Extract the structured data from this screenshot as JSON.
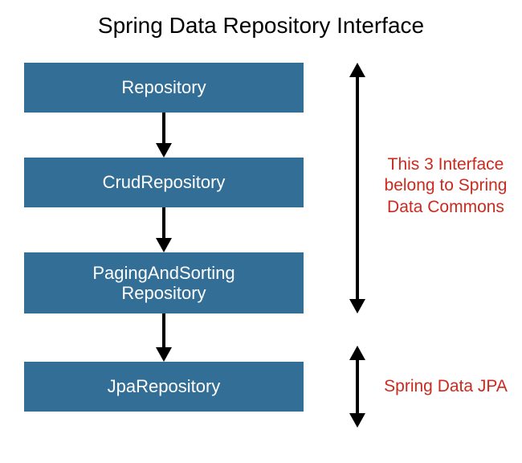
{
  "title": "Spring Data Repository Interface",
  "boxes": {
    "repository": "Repository",
    "crud": "CrudRepository",
    "paging_line1": "PagingAndSorting",
    "paging_line2": "Repository",
    "jpa": "JpaRepository"
  },
  "annotations": {
    "commons_line1": "This 3 Interface",
    "commons_line2": "belong to Spring",
    "commons_line3": "Data Commons",
    "jpa": "Spring Data JPA"
  },
  "colors": {
    "box_bg": "#336e97",
    "box_fg": "#ffffff",
    "annotation": "#cc2a1f",
    "arrow": "#000000"
  }
}
